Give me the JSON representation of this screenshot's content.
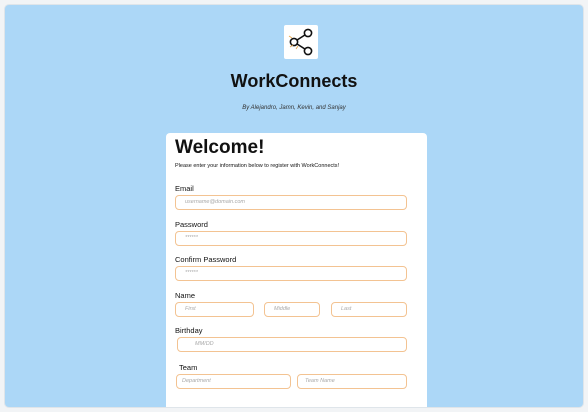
{
  "header": {
    "title": "WorkConnects",
    "byline": "By Alejandro, Jamn, Kevin, and Sanjay"
  },
  "form": {
    "heading": "Welcome!",
    "intro": "Please enter your information below to register with WorkConnects!",
    "email": {
      "label": "Email",
      "placeholder": "username@domain.com"
    },
    "password": {
      "label": "Password",
      "placeholder": "******"
    },
    "confirm_password": {
      "label": "Confirm Password",
      "placeholder": "******"
    },
    "name": {
      "label": "Name",
      "first_placeholder": "First",
      "middle_placeholder": "Middle",
      "last_placeholder": "Last"
    },
    "birthday": {
      "label": "Birthday",
      "placeholder": "MM/DD"
    },
    "team": {
      "label": "Team",
      "department_placeholder": "Department",
      "team_name_placeholder": "Team Name"
    }
  },
  "colors": {
    "background": "#acd7f7",
    "input_border": "#f3c392",
    "card": "#ffffff"
  },
  "icons": {
    "logo": "share-icon"
  }
}
